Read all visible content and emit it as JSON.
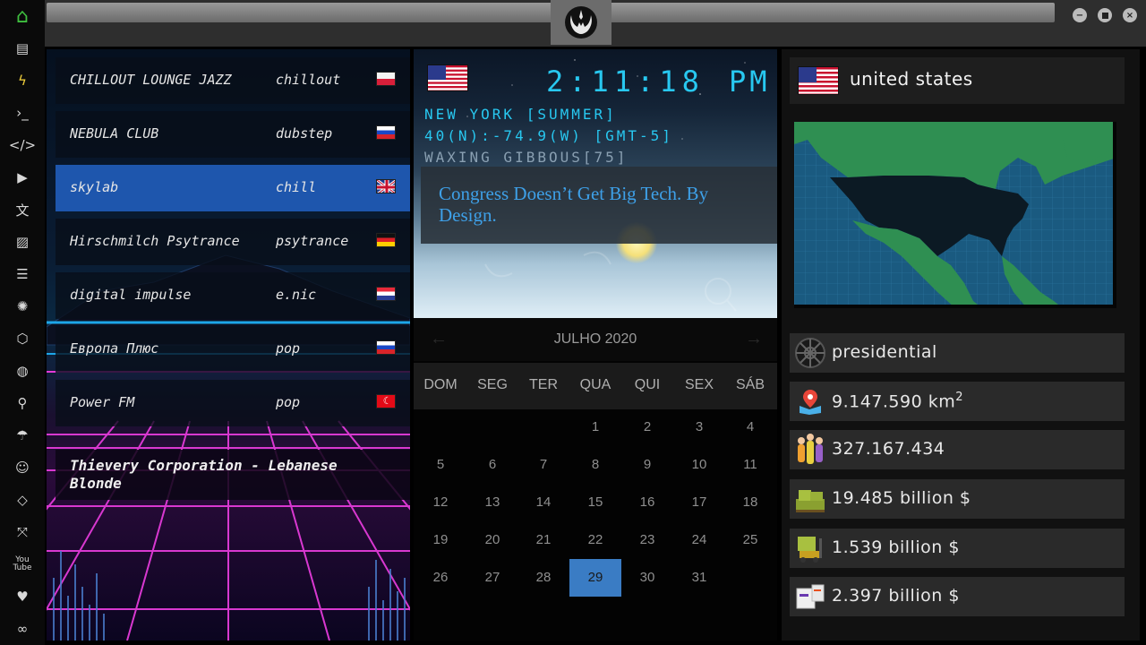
{
  "sidebar": {
    "icons": [
      "home-icon",
      "file-icon",
      "bolt-icon",
      "terminal-icon",
      "code-icon",
      "play-icon",
      "translate-icon",
      "image-icon",
      "news-icon",
      "rebel-icon",
      "hexagon-icon",
      "globe-icon",
      "search-icon",
      "umbrella-icon",
      "contact-icon",
      "link-icon",
      "expand-icon",
      "youtube-icon",
      "heart-icon",
      "infinity-icon"
    ],
    "youtube_label": "You Tube",
    "active_color": "#3fbf3f"
  },
  "radio": {
    "stations": [
      {
        "name": "CHILLOUT LOUNGE JAZZ",
        "genre": "chillout",
        "flag": "pl"
      },
      {
        "name": "NEBULA CLUB",
        "genre": "dubstep",
        "flag": "ru"
      },
      {
        "name": "skylab",
        "genre": "chill",
        "flag": "gb",
        "active": true
      },
      {
        "name": "Hirschmilch Psytrance",
        "genre": "psytrance",
        "flag": "de"
      },
      {
        "name": "digital impulse",
        "genre": "e.nic",
        "flag": "hr"
      },
      {
        "name": "Европа Плюс",
        "genre": "pop",
        "flag": "ru"
      },
      {
        "name": "Power FM",
        "genre": "pop",
        "flag": "tr"
      }
    ],
    "now_playing": "Thievery Corporation - Lebanese Blonde"
  },
  "clock": {
    "time": "2:11:18",
    "ampm": "PM",
    "city": "NEW YORK [SUMMER]",
    "coords": "40(N):-74.9(W) [GMT-5]",
    "moon": "WAXING GIBBOUS[75]",
    "news": "Congress Doesn’t Get Big Tech. By Design."
  },
  "calendar": {
    "month_label": "JULHO 2020",
    "weekdays": [
      "DOM",
      "SEG",
      "TER",
      "QUA",
      "QUI",
      "SEX",
      "SÁB"
    ],
    "weeks": [
      [
        "",
        "",
        "",
        "1",
        "2",
        "3",
        "4"
      ],
      [
        "5",
        "6",
        "7",
        "8",
        "9",
        "10",
        "11"
      ],
      [
        "12",
        "13",
        "14",
        "15",
        "16",
        "17",
        "18"
      ],
      [
        "19",
        "20",
        "21",
        "22",
        "23",
        "24",
        "25"
      ],
      [
        "26",
        "27",
        "28",
        "29",
        "30",
        "31",
        ""
      ]
    ],
    "today": "29"
  },
  "country": {
    "name": "united states",
    "government": "presidential",
    "area": "9.147.590 km",
    "area_unit_sup": "2",
    "population": "327.167.434",
    "stat_1": "19.485 billion $",
    "stat_2": "1.539 billion $",
    "stat_3": "2.397 billion $"
  }
}
